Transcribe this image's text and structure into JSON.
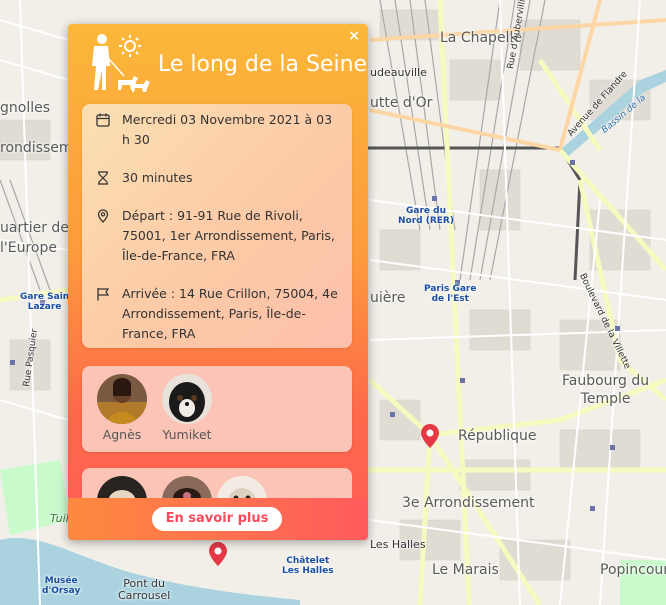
{
  "map": {
    "labels": {
      "la_chapelle": "La Chapelle",
      "place_ginols": "gnolles",
      "arrondissement_left": "rondissement",
      "quartier": "uartier de",
      "europe": "l'Europe",
      "gare_nord": "Gare du\nNord (RER)",
      "gare_est": "Paris Gare\nde l'Est",
      "gare_st_lazare": "Gare Sain\nLazare",
      "faubourg": "Faubourg du\nTemple",
      "republique": "République",
      "arr3": "3e Arrondissement",
      "le_marais": "Le Marais",
      "popincourt": "Popincourt",
      "chatelet": "Châtelet\nLes Halles",
      "musee_orsay": "Musée\nd'Orsay",
      "pont_carrousel": "Pont du\nCarrousel",
      "goutte_dor": "utte d'Or",
      "rue_aubervilliers": "Rue d'Aubervilliers",
      "bd_villette": "Boulevard de la Villette",
      "av_flandre": "Avenue de Flandre",
      "bassin": "Bassin de la",
      "rue_pasquier": "Rue Pasquier",
      "quiere": "uière",
      "chaussee": "udeauville",
      "les_halles": "Les Halles",
      "tuil": "Tuil"
    }
  },
  "popup": {
    "close_label": "×",
    "title": "Le long de la Seine",
    "date": "Mercredi 03 Novembre 2021 à 03 h 30",
    "duration": "30 minutes",
    "departure": "Départ : 91-91 Rue de Rivoli, 75001, 1er Arrondissement, Paris, Île-de-France, FRA",
    "arrival": "Arrivée : 14 Rue Crillon, 75004, 4e Arrondissement, Paris, Île-de-France, FRA",
    "participants": [
      {
        "name": "Agnès"
      },
      {
        "name": "Yumiket"
      }
    ],
    "more_button": "En savoir plus"
  },
  "colors": {
    "accent": "#ff4a5e",
    "header_orange": "#fbb83a",
    "pin_red": "#e53945"
  }
}
